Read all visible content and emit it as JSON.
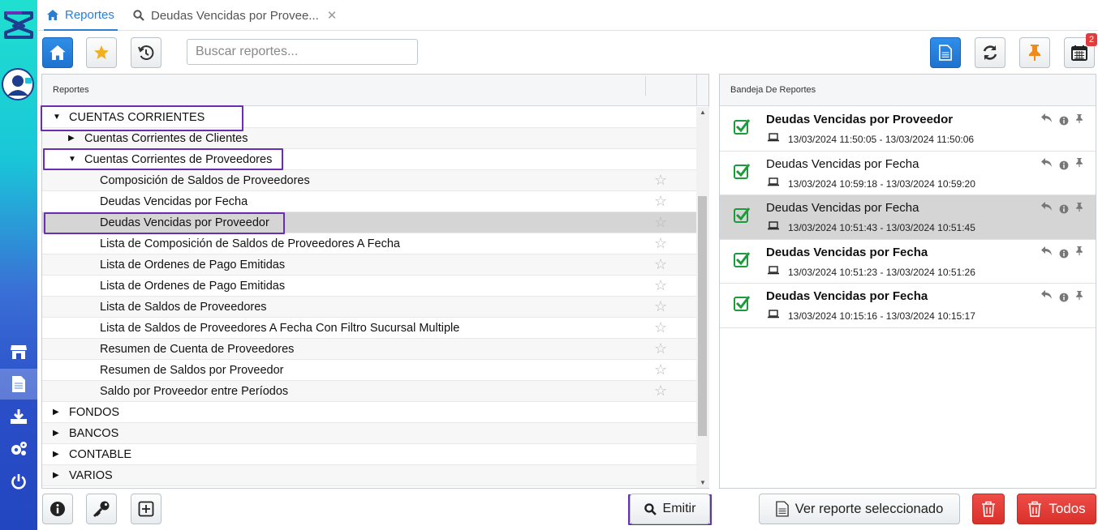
{
  "tabs": [
    {
      "label": "Reportes"
    },
    {
      "label": "Deudas Vencidas por Provee..."
    }
  ],
  "toolbar": {
    "search_placeholder": "Buscar reportes...",
    "calendar_badge": "2"
  },
  "left_panel": {
    "header": "Reportes",
    "rows": [
      {
        "label": "CUENTAS CORRIENTES",
        "level": 0,
        "arrow": "▼"
      },
      {
        "label": "Cuentas Corrientes de Clientes",
        "level": 1,
        "arrow": "▶"
      },
      {
        "label": "Cuentas Corrientes de Proveedores",
        "level": 1,
        "arrow": "▼"
      },
      {
        "label": "Composición de Saldos de Proveedores",
        "level": 2,
        "star": "☆"
      },
      {
        "label": "Deudas Vencidas por Fecha",
        "level": 2,
        "star": "☆"
      },
      {
        "label": "Deudas Vencidas por Proveedor",
        "level": 2,
        "star": "☆",
        "selected": true
      },
      {
        "label": "Lista de Composición de Saldos de Proveedores A Fecha",
        "level": 2,
        "star": "☆"
      },
      {
        "label": "Lista de Ordenes de Pago Emitidas",
        "level": 2,
        "star": "☆"
      },
      {
        "label": "Lista de Ordenes de Pago Emitidas",
        "level": 2,
        "star": "☆"
      },
      {
        "label": "Lista de Saldos de Proveedores",
        "level": 2,
        "star": "☆"
      },
      {
        "label": "Lista de Saldos de Proveedores A Fecha Con Filtro Sucursal Multiple",
        "level": 2,
        "star": "☆"
      },
      {
        "label": "Resumen de Cuenta de Proveedores",
        "level": 2,
        "star": "☆"
      },
      {
        "label": "Resumen de Saldos por Proveedor",
        "level": 2,
        "star": "☆"
      },
      {
        "label": "Saldo por Proveedor entre Períodos",
        "level": 2,
        "star": "☆"
      },
      {
        "label": "FONDOS",
        "level": 0,
        "arrow": "▶"
      },
      {
        "label": "BANCOS",
        "level": 0,
        "arrow": "▶"
      },
      {
        "label": "CONTABLE",
        "level": 0,
        "arrow": "▶"
      },
      {
        "label": "VARIOS",
        "level": 0,
        "arrow": "▶"
      }
    ]
  },
  "right_panel": {
    "header": "Bandeja De Reportes",
    "items": [
      {
        "title": "Deudas Vencidas por Proveedor",
        "time": "13/03/2024 11:50:05 - 13/03/2024 11:50:06",
        "bold": true
      },
      {
        "title": "Deudas Vencidas por Fecha",
        "time": "13/03/2024 10:59:18 - 13/03/2024 10:59:20",
        "bold": false
      },
      {
        "title": "Deudas Vencidas por Fecha",
        "time": "13/03/2024 10:51:43 - 13/03/2024 10:51:45",
        "bold": false,
        "selected": true
      },
      {
        "title": "Deudas Vencidas por Fecha",
        "time": "13/03/2024 10:51:23 - 13/03/2024 10:51:26",
        "bold": true
      },
      {
        "title": "Deudas Vencidas por Fecha",
        "time": "13/03/2024 10:15:16 - 13/03/2024 10:15:17",
        "bold": true
      }
    ]
  },
  "bottom": {
    "emitir": "Emitir",
    "ver_reporte": "Ver reporte seleccionado",
    "todos": "Todos"
  },
  "colors": {
    "accent": "#2a7fd4",
    "highlight": "#6a2fb0",
    "danger": "#e0352f",
    "check": "#1c9b3a"
  }
}
